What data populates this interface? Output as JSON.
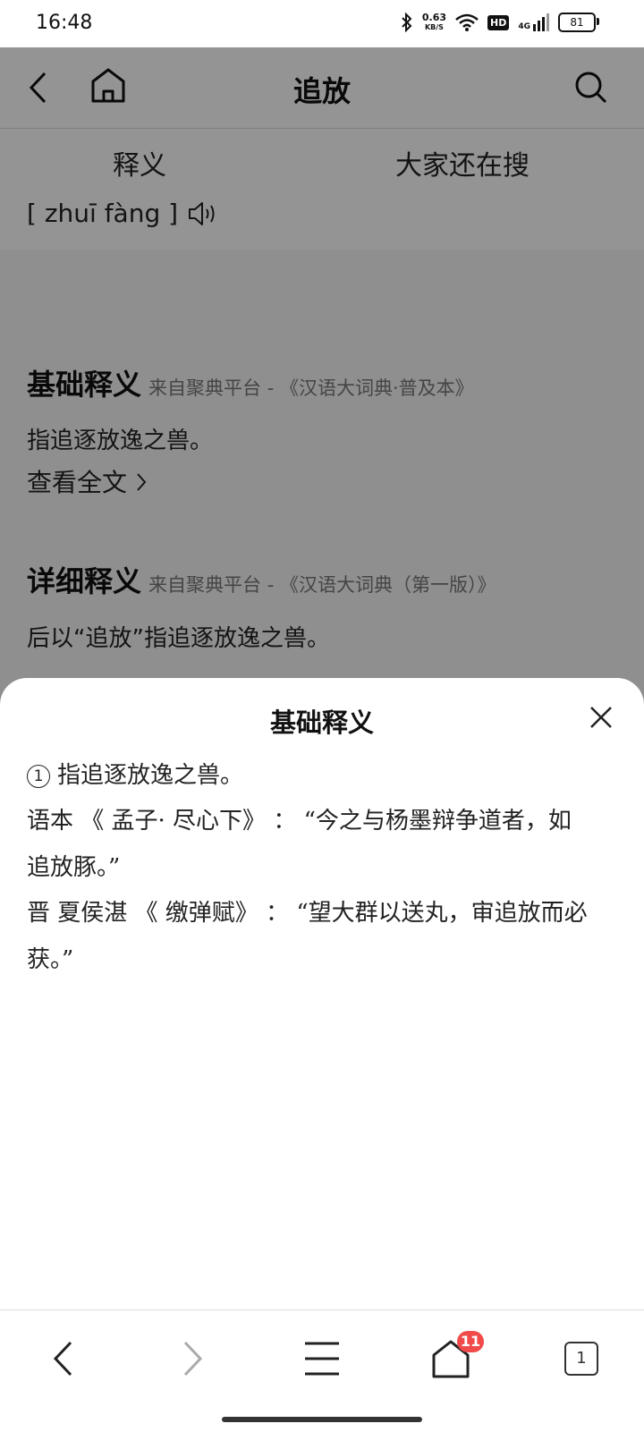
{
  "status_bar": {
    "time": "16:48",
    "speed_value": "0.63",
    "speed_unit": "KB/S",
    "hd": "HD",
    "network": "4G",
    "battery": "81"
  },
  "header": {
    "title": "追放"
  },
  "tabs": {
    "tab1": "释义",
    "tab2": "大家还在搜"
  },
  "pinyin": "[ zhuī fàng ]",
  "basic": {
    "title": "基础释义",
    "source": "来自聚典平台 - 《汉语大词典·普及本》",
    "text": "指追逐放逸之兽。",
    "more": "查看全文"
  },
  "detail": {
    "title": "详细释义",
    "source": "来自聚典平台 - 《汉语大词典（第一版）》",
    "text": "后以“追放”指追逐放逸之兽。"
  },
  "sheet": {
    "title": "基础释义",
    "num": "1",
    "line1": "指追逐放逸之兽。",
    "line2": "语本 《 孟子· 尽心下》 ：  “今之与杨墨辩争道者，如",
    "line3": "追放豚。”",
    "line4": "晋 夏侯湛 《 缴弹赋》 ：  “望大群以送丸，审追放而必",
    "line5": "获。”"
  },
  "bottom_bar": {
    "home_badge": "11",
    "tab_count": "1"
  },
  "colors": {
    "badge": "#f04a4a",
    "overlay": "rgba(0,0,0,0.42)"
  }
}
